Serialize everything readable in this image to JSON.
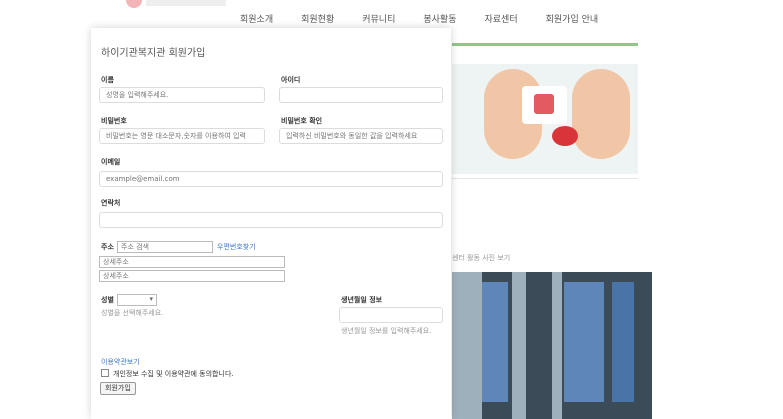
{
  "nav": {
    "items": [
      "회원소개",
      "회원현황",
      "커뮤니티",
      "봉사활동",
      "자료센터",
      "회원가입 안내"
    ]
  },
  "side": {
    "caption": "센터 활동 사진 보기"
  },
  "modal": {
    "title": "하이기관복지관 회원가입",
    "fields": {
      "name_label": "이름",
      "name_placeholder": "성명을 입력해주세요.",
      "id_label": "아이디",
      "id_placeholder": "",
      "password_label": "비밀번호",
      "password_placeholder": "비밀번호는 영문 대소문자,숫자를 이용하여 입력",
      "password_confirm_label": "비밀번호 확인",
      "password_confirm_placeholder": "입력하신 비밀번호와 동일한 값을 입력하세요",
      "email_label": "이메일",
      "email_placeholder": "example@email.com",
      "phone_label": "연락처",
      "phone_placeholder": "",
      "address_label": "주소",
      "address_search_placeholder": "주소 검색",
      "address_search_link": "우편번호찾기",
      "address1_placeholder": "상세주소",
      "address2_placeholder": "상세주소",
      "gender_label": "성별",
      "gender_help": "성별을 선택해주세요.",
      "birth_label": "생년월일 정보",
      "birth_placeholder": "",
      "birth_help": "생년월일 정보를 입력해주세요."
    },
    "terms_link": "이용약관보기",
    "agree_text": "개인정보 수집 및 이용약관에 동의합니다.",
    "submit_label": "회원가입"
  }
}
